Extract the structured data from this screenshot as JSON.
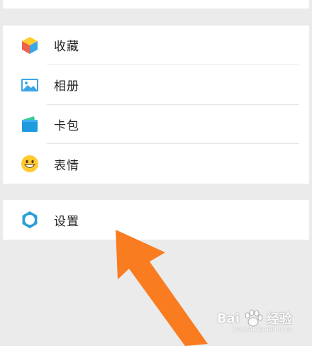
{
  "menu": {
    "items": [
      {
        "label": "收藏",
        "icon": "cube-icon"
      },
      {
        "label": "相册",
        "icon": "image-icon"
      },
      {
        "label": "卡包",
        "icon": "wallet-icon"
      },
      {
        "label": "表情",
        "icon": "smiley-icon"
      }
    ],
    "settings": {
      "label": "设置",
      "icon": "gear-icon"
    }
  },
  "watermark": {
    "brand": "Bai",
    "suffix": "经验",
    "sub": "jingyan.baidu.com"
  },
  "colors": {
    "arrow": "#f97c21",
    "settings_icon": "#2a9fd6",
    "background": "#ebebeb"
  }
}
